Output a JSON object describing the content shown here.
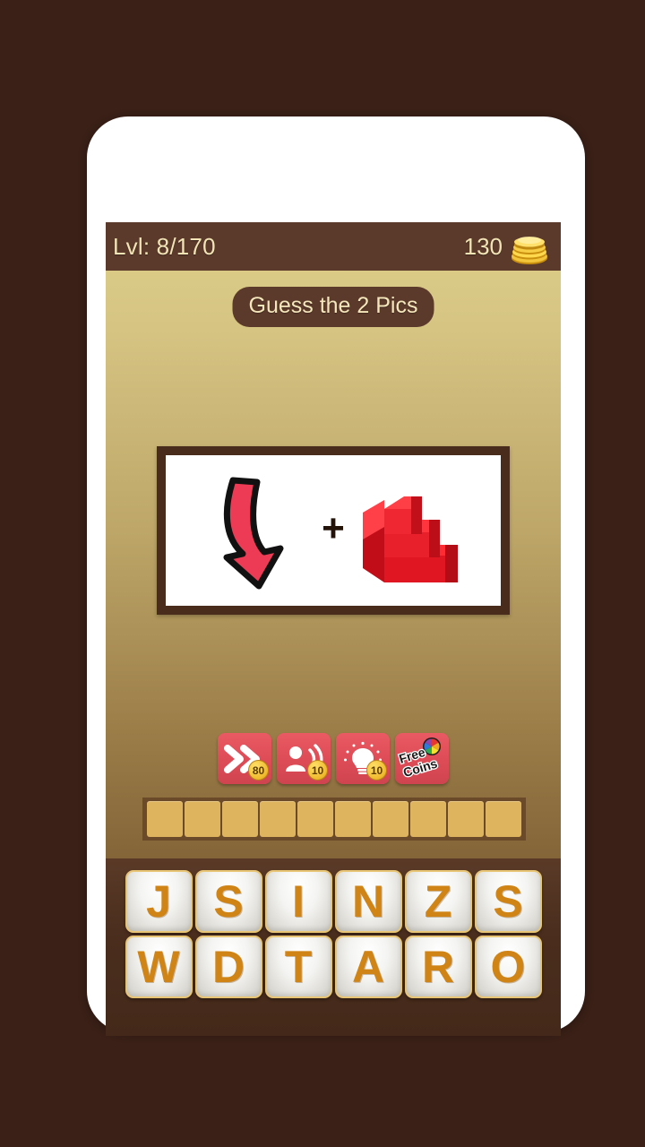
{
  "theme": {
    "page_background": "#3a2017",
    "phone_body": "#ffffff",
    "status_bar": "#5b3a2b",
    "screen_gradient_top": "#ddd08a",
    "screen_gradient_bottom": "#6b4d2b",
    "keyboard_background": "#4a2d1d",
    "accent_red": "#dd4c56",
    "accent_gold": "#f0b92c",
    "letter_color": "#cf8415",
    "slot_color": "#dfb45f",
    "text_cream": "#f2e4b5"
  },
  "status_bar": {
    "level_label": "Lvl: 8/170",
    "coin_count": "130",
    "coin_icon": "coin-stack-icon"
  },
  "title": {
    "text": "Guess the 2 Pics"
  },
  "puzzle": {
    "pictures": [
      {
        "name": "red-down-arrow",
        "alt": "red curved down arrow"
      },
      {
        "name": "red-stairs",
        "alt": "red 3D staircase"
      }
    ],
    "separator": "+"
  },
  "powerups": [
    {
      "name": "skip-button",
      "icon": "double-chevron-icon",
      "cost": "80"
    },
    {
      "name": "ask-friend-button",
      "icon": "person-shout-icon",
      "cost": "10"
    },
    {
      "name": "hint-button",
      "icon": "lightbulb-icon",
      "cost": "10"
    },
    {
      "name": "free-coins-button",
      "icon": "color-wheel-icon",
      "label_line1": "Free",
      "label_line2": "Coins"
    }
  ],
  "answer": {
    "slot_count": 10,
    "slots": [
      "",
      "",
      "",
      "",
      "",
      "",
      "",
      "",
      "",
      ""
    ]
  },
  "keyboard": {
    "rows": [
      [
        "J",
        "S",
        "I",
        "N",
        "Z",
        "S"
      ],
      [
        "W",
        "D",
        "T",
        "A",
        "R",
        "O"
      ]
    ]
  }
}
